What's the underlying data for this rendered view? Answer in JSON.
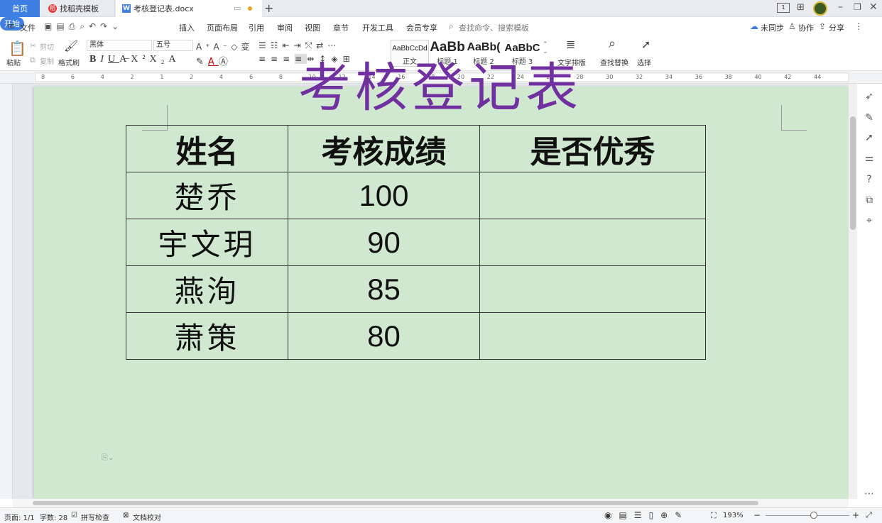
{
  "tabs": {
    "home": "首页",
    "templates": "找稻壳模板",
    "doc": "考核登记表.docx",
    "new_tab": "+"
  },
  "menubar": {
    "file": "文件",
    "items": [
      "开始",
      "插入",
      "页面布局",
      "引用",
      "审阅",
      "视图",
      "章节",
      "开发工具",
      "会员专享"
    ],
    "search_placeholder": "查找命令、搜索模板",
    "sync": "未同步",
    "collab": "协作",
    "share": "分享"
  },
  "ribbon": {
    "paste": "粘贴",
    "cut": "剪切",
    "copy": "复制",
    "format_painter": "格式刷",
    "font_name": "黑体",
    "font_size": "五号",
    "styles": [
      {
        "sample": "AaBbCcDd",
        "label": "正文"
      },
      {
        "sample": "AaBb",
        "label": "标题 1"
      },
      {
        "sample": "AaBb(",
        "label": "标题 2"
      },
      {
        "sample": "AaBbC",
        "label": "标题 3"
      }
    ],
    "text_layout": "文字排版",
    "find_replace": "查找替换",
    "select": "选择"
  },
  "ruler": {
    "ticks": [
      "8",
      "6",
      "4",
      "2",
      "1",
      "2",
      "4",
      "6",
      "8",
      "10",
      "12",
      "14",
      "16",
      "18",
      "20",
      "22",
      "24",
      "26",
      "28",
      "30",
      "32",
      "34",
      "36",
      "38",
      "40",
      "42",
      "44"
    ]
  },
  "document": {
    "title": "考核登记表",
    "headers": [
      "姓名",
      "考核成绩",
      "是否优秀"
    ],
    "rows": [
      {
        "name": "楚乔",
        "score": "100",
        "excellent": ""
      },
      {
        "name": "宇文玥",
        "score": "90",
        "excellent": ""
      },
      {
        "name": "燕洵",
        "score": "85",
        "excellent": ""
      },
      {
        "name": "萧策",
        "score": "80",
        "excellent": ""
      }
    ]
  },
  "status": {
    "page": "页面: 1/1",
    "words": "字数: 28",
    "spell": "拼写检查",
    "proof": "文档校对",
    "zoom": "193%"
  },
  "colors": {
    "accent": "#3f7fe4",
    "page_bg": "#cfe8cf",
    "title": "#7030a0"
  }
}
